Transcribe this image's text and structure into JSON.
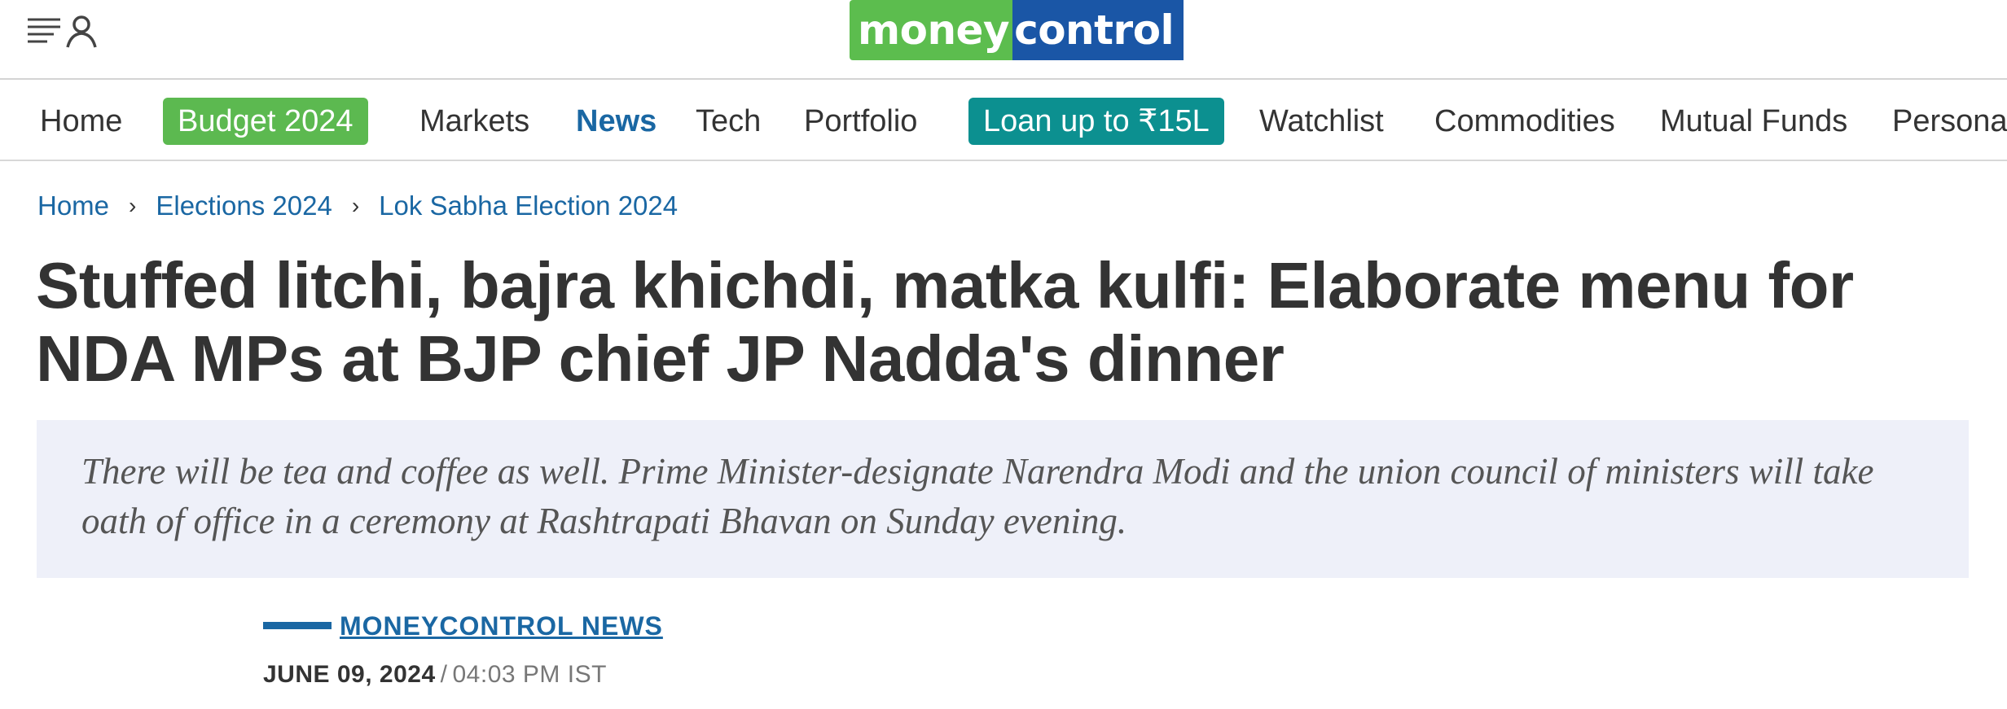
{
  "header": {
    "logo_part1": "money",
    "logo_part2": "control",
    "menu_icon": "hamburger-menu-icon",
    "user_icon": "user-icon"
  },
  "nav": {
    "items": [
      "Home",
      "Budget 2024",
      "Markets",
      "News",
      "Tech",
      "Portfolio",
      "Loan up to ₹15L",
      "Watchlist",
      "Commodities",
      "Mutual Funds",
      "Persona"
    ],
    "active": "News",
    "budget_color": "#5cb950",
    "loan_color": "#0c9090"
  },
  "breadcrumb": [
    "Home",
    "Elections 2024",
    "Lok Sabha Election 2024"
  ],
  "article": {
    "title": "Stuffed litchi, bajra khichdi, matka kulfi: Elaborate menu for NDA MPs at BJP chief JP Nadda's dinner",
    "summary": "There will be tea and coffee as well. Prime Minister-designate Narendra Modi and the union council of ministers will take oath of office in a ceremony at Rashtrapati Bhavan on Sunday evening.",
    "author": "MONEYCONTROL NEWS",
    "date": "JUNE 09, 2024",
    "separator": "/",
    "time": "04:03 PM IST"
  },
  "colors": {
    "brand_green": "#5cbd4e",
    "brand_blue": "#1a56a6",
    "link_blue": "#1a67a3",
    "summary_bg": "#eef0f9"
  }
}
